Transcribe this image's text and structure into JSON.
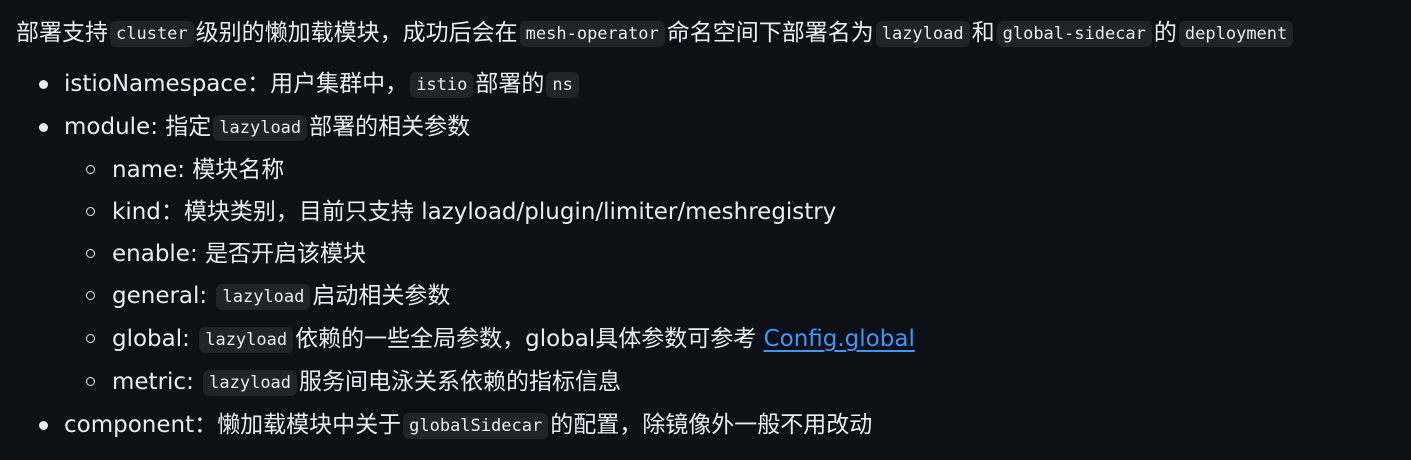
{
  "intro": {
    "t1": "部署支持",
    "c1": "cluster",
    "t2": "级别的懒加载模块，成功后会在",
    "c2": "mesh-operator",
    "t3": "命名空间下部署名为",
    "c3": "lazyload",
    "t4": "和",
    "c4": "global-sidecar",
    "t5": "的",
    "c5": "deployment"
  },
  "items": {
    "istio_ns": {
      "t1": "istioNamespace：用户集群中，",
      "c1": "istio",
      "t2": "部署的",
      "c2": "ns"
    },
    "module": {
      "t1": "module: 指定",
      "c1": "lazyload",
      "t2": "部署的相关参数",
      "sub": {
        "name": {
          "t1": "name: 模块名称"
        },
        "kind": {
          "t1": "kind：模块类别，目前只支持 lazyload/plugin/limiter/meshregistry"
        },
        "enable": {
          "t1": "enable: 是否开启该模块"
        },
        "general": {
          "t1": "general:",
          "c1": "lazyload",
          "t2": "启动相关参数"
        },
        "global": {
          "t1": "global:",
          "c1": "lazyload",
          "t2": "依赖的一些全局参数，global具体参数可参考",
          "link": "Config.global"
        },
        "metric": {
          "t1": "metric:",
          "c1": "lazyload",
          "t2": "服务间电泳关系依赖的指标信息"
        }
      }
    },
    "component": {
      "t1": "component：懒加载模块中关于",
      "c1": "globalSidecar",
      "t2": "的配置，除镜像外一般不用改动"
    }
  },
  "colors": {
    "background": "#0d1117",
    "text": "#e6edf3",
    "code_bg": "#1f2428",
    "link": "#4493f8"
  }
}
